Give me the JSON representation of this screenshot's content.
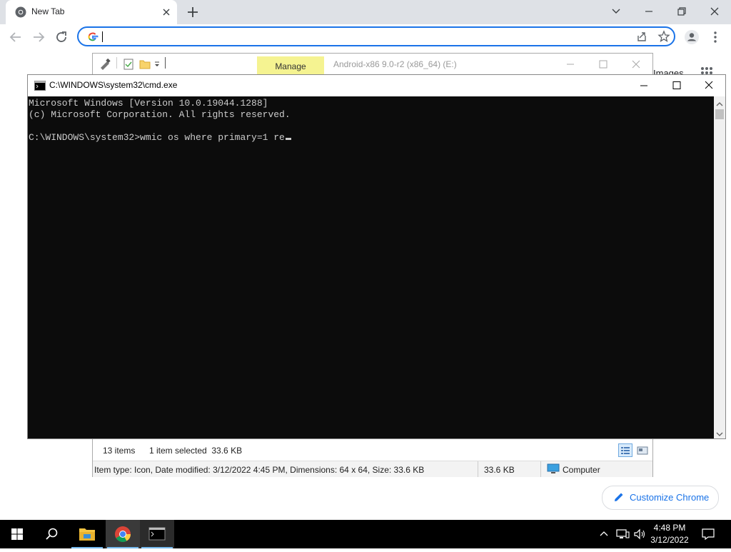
{
  "chrome": {
    "tab_title": "New Tab",
    "omnibox_value": "",
    "customize_label": "Customize Chrome",
    "images_label": "Images"
  },
  "explorer": {
    "manage_label": "Manage",
    "title": "Android-x86 9.0-r2 (x86_64) (E:)",
    "items_count": "13 items",
    "selected": "1 item selected  33.6 KB",
    "details": "Item type: Icon, Date modified: 3/12/2022 4:45 PM, Dimensions: 64 x 64, Size: 33.6 KB",
    "size": "33.6 KB",
    "location": "Computer"
  },
  "cmd": {
    "title": "C:\\WINDOWS\\system32\\cmd.exe",
    "lines": [
      "Microsoft Windows [Version 10.0.19044.1288]",
      "(c) Microsoft Corporation. All rights reserved.",
      "",
      "C:\\WINDOWS\\system32>wmic os where primary=1 re"
    ]
  },
  "taskbar": {
    "time": "4:48 PM",
    "date": "3/12/2022"
  },
  "colors": {
    "chrome_accent": "#1a73e8",
    "console_bg": "#0c0c0c",
    "console_text": "#cccccc",
    "manage_highlight": "#f5f391"
  }
}
